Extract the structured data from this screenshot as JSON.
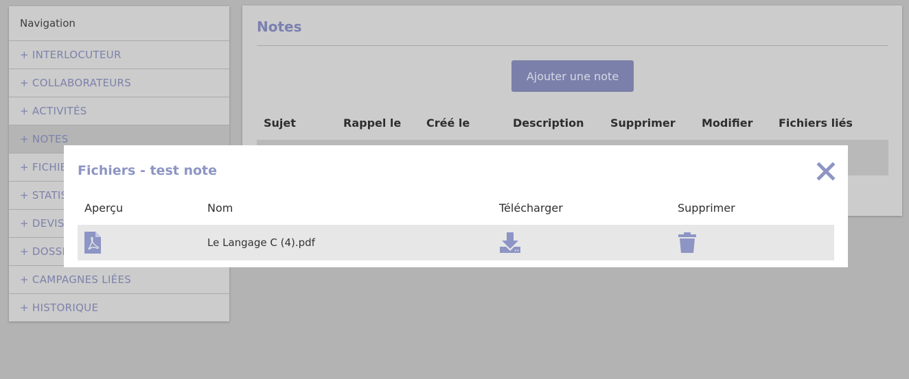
{
  "sidebar": {
    "header": "Navigation",
    "items": [
      {
        "label": "+ INTERLOCUTEUR"
      },
      {
        "label": "+ COLLABORATEURS"
      },
      {
        "label": "+ ACTIVITÉS"
      },
      {
        "label": "+ NOTES"
      },
      {
        "label": "+ FICHIE"
      },
      {
        "label": "+ STATIS"
      },
      {
        "label": "+ DEVIS/"
      },
      {
        "label": "+ DOSSI"
      },
      {
        "label": "+ CAMPAGNES LIÉES"
      },
      {
        "label": "+ HISTORIQUE"
      }
    ]
  },
  "main": {
    "title": "Notes",
    "add_button": "Ajouter une note",
    "columns": [
      "Sujet",
      "Rappel le",
      "Créé le",
      "Description",
      "Supprimer",
      "Modifier",
      "Fichiers liés"
    ]
  },
  "modal": {
    "title": "Fichiers - test note",
    "columns": [
      "Aperçu",
      "Nom",
      "Télécharger",
      "Supprimer"
    ],
    "files": [
      {
        "preview_icon": "pdf-file-icon",
        "name": "Le Langage C (4).pdf",
        "download_icon": "download-icon",
        "delete_icon": "trash-icon"
      }
    ]
  },
  "colors": {
    "accent": "#7a80b0",
    "modal_accent": "#8d95c4",
    "icon": "#8d95c4",
    "overlay": "#b3b3b3"
  }
}
